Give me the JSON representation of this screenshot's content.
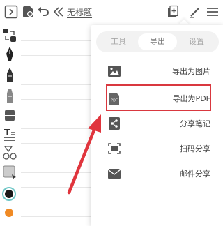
{
  "toolbar": {
    "doc_title": "无标题"
  },
  "menu": {
    "tabs": [
      {
        "label": "工具",
        "active": false
      },
      {
        "label": "导出",
        "active": true
      },
      {
        "label": "设置",
        "active": false
      }
    ],
    "items": [
      {
        "label": "导出为图片",
        "icon": "image-icon"
      },
      {
        "label": "导出为PDF",
        "icon": "pdf-icon",
        "highlighted": true
      },
      {
        "label": "分享笔记",
        "icon": "share-icon"
      },
      {
        "label": "扫码分享",
        "icon": "qr-scan-icon"
      },
      {
        "label": "邮件分享",
        "icon": "mail-icon"
      }
    ],
    "pdf_icon_text": "PDF"
  },
  "colors": {
    "icon_gray": "#555555",
    "highlight_red": "#d9383f",
    "arrow_red": "#e0353d",
    "pen_black": "#1a1a1a",
    "pen_orange": "#f08a24"
  }
}
